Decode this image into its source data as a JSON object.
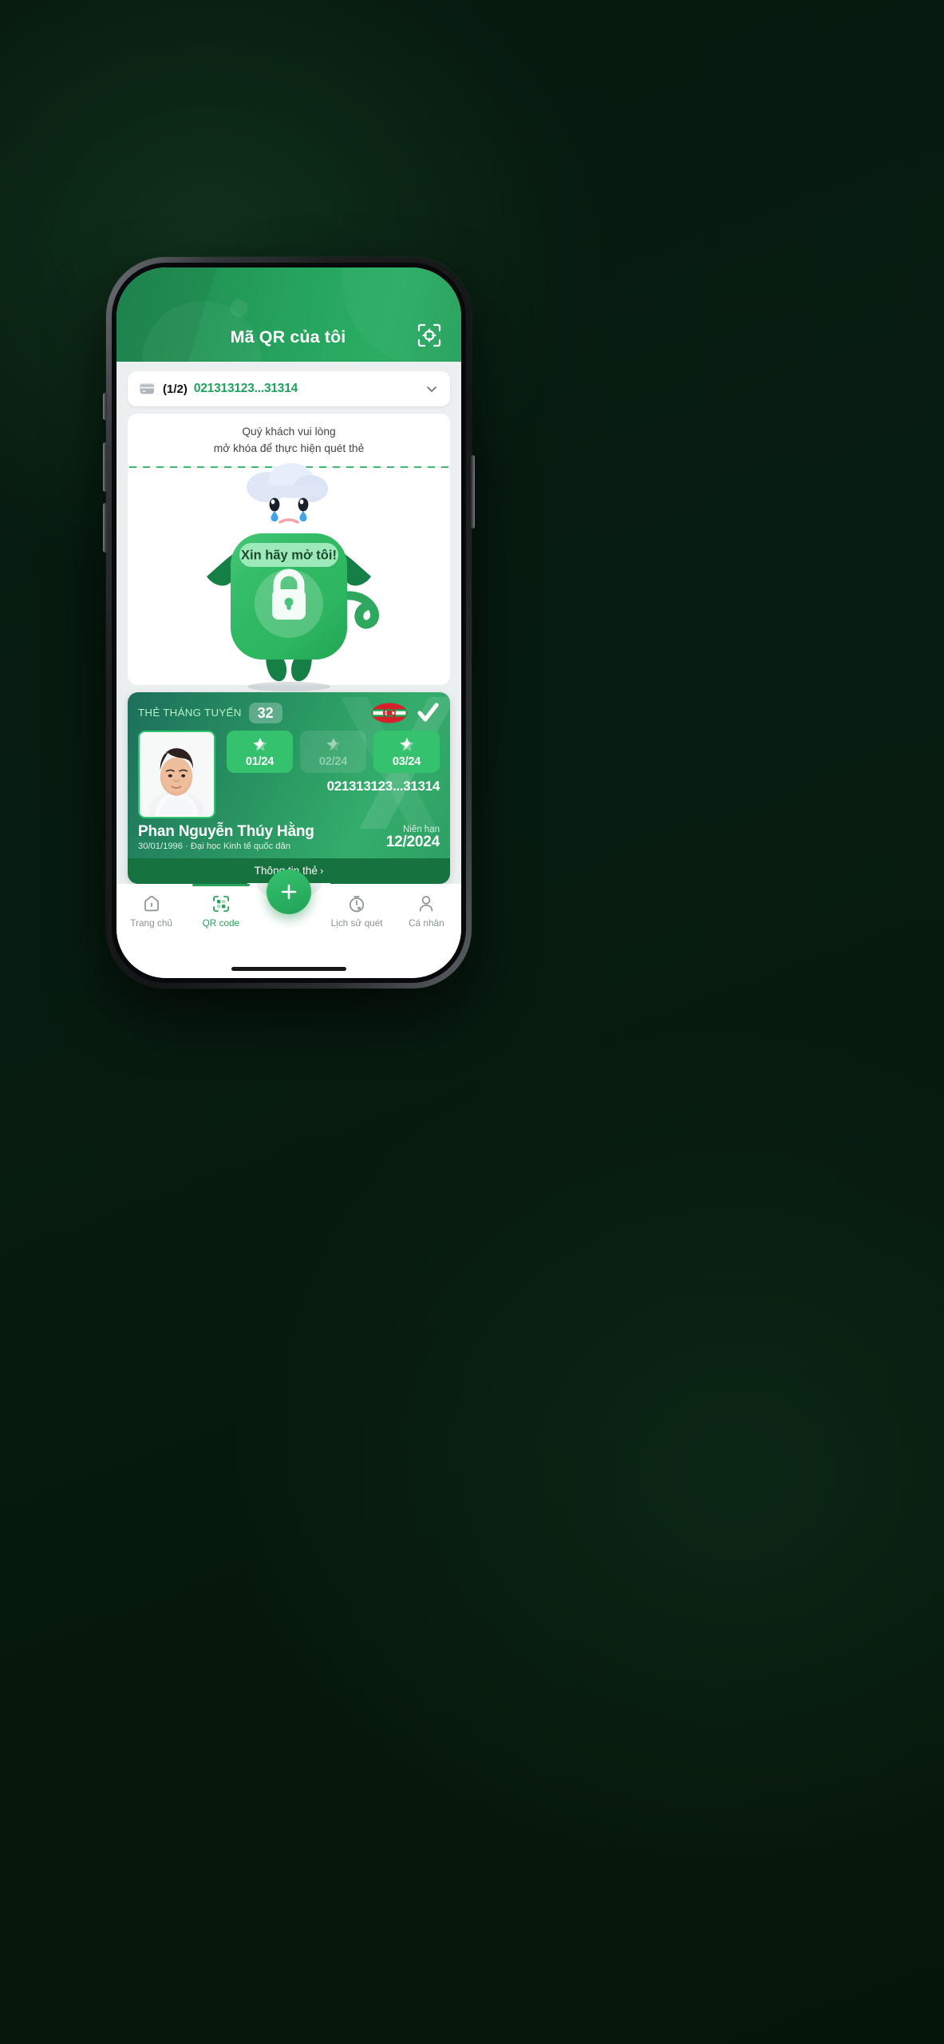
{
  "theme": {
    "brand_green": "#27a35c",
    "header_green": "#26a45e",
    "card_green": "#2b9a63",
    "accent_light": "#b4f0c9",
    "background_dark": "#071c10"
  },
  "header": {
    "title": "Mã QR của tôi",
    "scan_icon": "scan-qr-icon"
  },
  "card_selector": {
    "card_icon": "card-icon",
    "count": "(1/2)",
    "number": "021313123...31314",
    "chevron_icon": "chevron-down-icon"
  },
  "unlock_notice": {
    "line1": "Quý khách vui lòng",
    "line2": "mở khóa để thực hiện quét thẻ"
  },
  "mascot": {
    "speech_bubble": "Xin hãy mở tôi!",
    "lock_icon": "lock-icon",
    "cloud_icon": "rain-cloud-icon",
    "face": "crying-face"
  },
  "member_card": {
    "type_label": "THẺ THÁNG TUYẾN",
    "badge_value": "32",
    "logo_name": "htc-logo",
    "verified_icon": "check-icon",
    "avatar": "member-photo",
    "months": [
      {
        "label": "01/24",
        "active": true,
        "icon": "star-icon"
      },
      {
        "label": "02/24",
        "active": false,
        "icon": "star-icon"
      },
      {
        "label": "03/24",
        "active": true,
        "icon": "star-icon"
      }
    ],
    "card_number": "021313123...31314",
    "holder_name": "Phan Nguyễn Thúy Hằng",
    "holder_sub": "30/01/1996 · Đại học Kinh tế quốc dân",
    "expiry_label": "Niên hạn",
    "expiry_value": "12/2024",
    "footer_label": "Thông tin thẻ",
    "footer_chevron": "›"
  },
  "bottom_nav": {
    "items": [
      {
        "label": "Trang chủ",
        "icon": "home-icon",
        "active": false
      },
      {
        "label": "QR code",
        "icon": "qr-icon",
        "active": true
      },
      {
        "label": "Lịch sử quét",
        "icon": "history-icon",
        "active": false
      },
      {
        "label": "Cá nhân",
        "icon": "person-icon",
        "active": false
      }
    ],
    "fab_icon": "plus-icon"
  }
}
